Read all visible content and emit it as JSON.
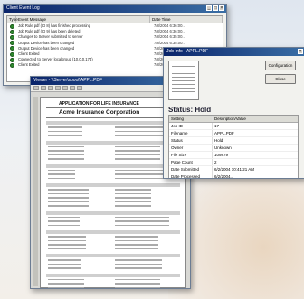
{
  "event_log": {
    "title": "Client Event Log",
    "columns": [
      "Type",
      "Event Message",
      "Date Time"
    ],
    "rows": [
      {
        "message": "Job Rule pdf (ID 8) has finished processing",
        "datetime": "7/8/2004 6:36:00..."
      },
      {
        "message": "Job Rule pdf (ID 9) has been deleted",
        "datetime": "7/8/2004 6:36:00..."
      },
      {
        "message": "Changes to Server submitted to server",
        "datetime": "7/8/2004 6:35:00..."
      },
      {
        "message": "Output Device has been changed",
        "datetime": "7/8/2004 6:35:00..."
      },
      {
        "message": "Output Device has been changed",
        "datetime": "7/8/2004 6:34:00..."
      },
      {
        "message": "Client Exited",
        "datetime": "7/8/2004 6:33:00..."
      },
      {
        "message": "Connected to Server localgroup (10.0.0.174)",
        "datetime": "7/8/2004 6:33:00..."
      },
      {
        "message": "Client Exited",
        "datetime": "7/8/2004 6:32:00..."
      }
    ]
  },
  "job_info": {
    "title": "Job Info - APPL.PDF",
    "configuration_label": "Configuration",
    "close_label": "Close",
    "status": "Status: Hold",
    "columns": [
      "Setting",
      "Description/Value"
    ],
    "rows": [
      {
        "setting": "Job ID",
        "value": "17"
      },
      {
        "setting": "Filename",
        "value": "APPL.PDF"
      },
      {
        "setting": "Status",
        "value": "Hold"
      },
      {
        "setting": "Owner",
        "value": "Unknown"
      },
      {
        "setting": "File Size",
        "value": "109879"
      },
      {
        "setting": "Page Count",
        "value": "2"
      },
      {
        "setting": "Date Submitted",
        "value": "6/2/2004 10:41:21 AM"
      },
      {
        "setting": "Date Processed",
        "value": "6/2/2004..."
      }
    ]
  },
  "viewer": {
    "title": "Viewer - \\\\Server\\spool\\APPL.PDF",
    "doc_heading": "APPLICATION FOR LIFE INSURANCE",
    "doc_company": "Acme Insurance Corporation"
  },
  "colors": {
    "titlebar": "#0a246a",
    "status_ok": "#2f8a2f"
  }
}
